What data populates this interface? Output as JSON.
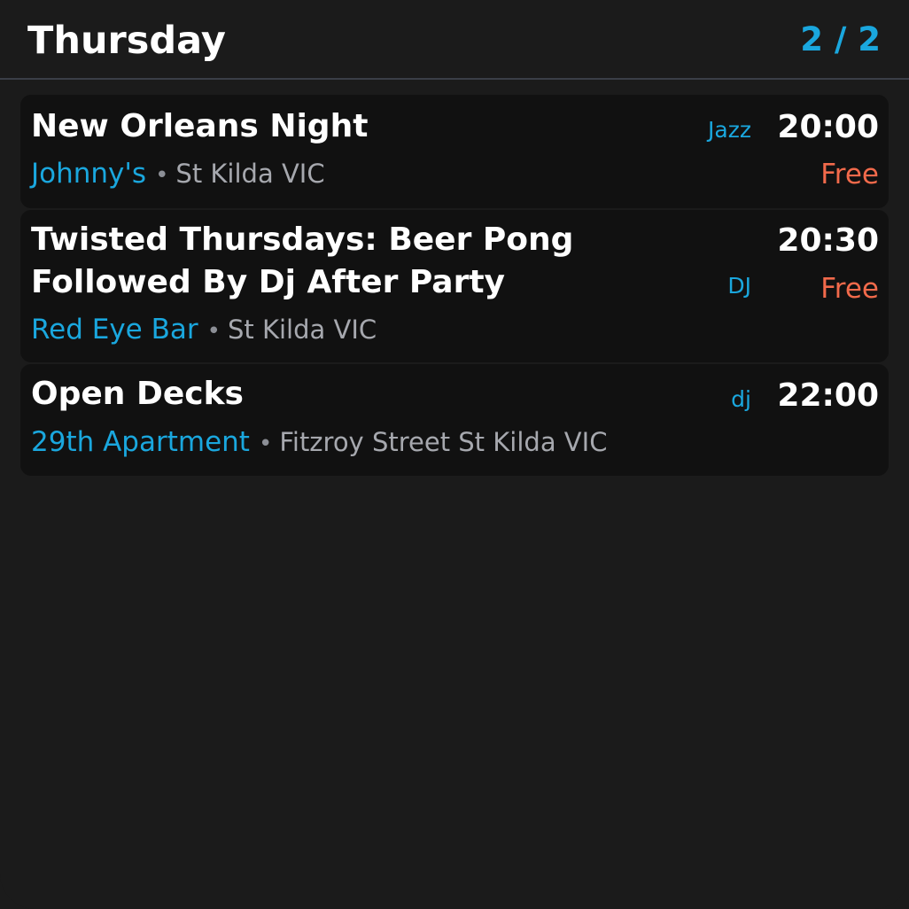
{
  "header": {
    "title": "Thursday",
    "page_indicator": "2 / 2"
  },
  "events": [
    {
      "title": "New Orleans Night",
      "venue": "Johnny's",
      "separator": "•",
      "location": "St Kilda VIC",
      "genre": "Jazz",
      "time": "20:00",
      "price": "Free"
    },
    {
      "title": "Twisted Thursdays: Beer Pong Followed By Dj After Party",
      "venue": "Red Eye Bar",
      "separator": "•",
      "location": "St Kilda VIC",
      "genre": "DJ",
      "time": "20:30",
      "price": "Free"
    },
    {
      "title": "Open Decks",
      "venue": "29th Apartment",
      "separator": "•",
      "location": "Fitzroy Street St Kilda VIC",
      "genre": "dj",
      "time": "22:00"
    }
  ],
  "colors": {
    "background": "#1b1b1b",
    "card": "#111111",
    "accent": "#1aa7de",
    "price": "#f26a4b",
    "muted": "#a6a8ae"
  }
}
